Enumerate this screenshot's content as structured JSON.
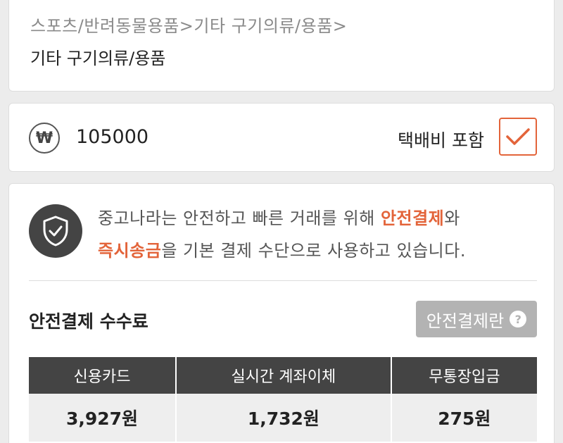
{
  "category": {
    "breadcrumb": "스포츠/반려동물용품>기타 구기의류/용품>",
    "name": "기타 구기의류/용품"
  },
  "price": {
    "currency_icon": "₩",
    "value": "105000",
    "shipping_label": "택배비 포함",
    "shipping_included": true
  },
  "safe_payment": {
    "notice_prefix": "중고나라는 안전하고 빠른 거래를 위해 ",
    "notice_highlight_1": "안전결제",
    "notice_mid_1": "와",
    "notice_highlight_2": "즉시송금",
    "notice_suffix": "을 기본 결제 수단으로 사용하고 있습니다.",
    "fee_title": "안전결제 수수료",
    "info_button_label": "안전결제란",
    "info_button_icon": "?",
    "fee_table": {
      "headers": [
        "신용카드",
        "실시간 계좌이체",
        "무통장입금"
      ],
      "values": [
        "3,927원",
        "1,732원",
        "275원"
      ]
    }
  },
  "colors": {
    "accent": "#e3643a",
    "dark": "#444444",
    "button_gray": "#b3b3b3"
  }
}
